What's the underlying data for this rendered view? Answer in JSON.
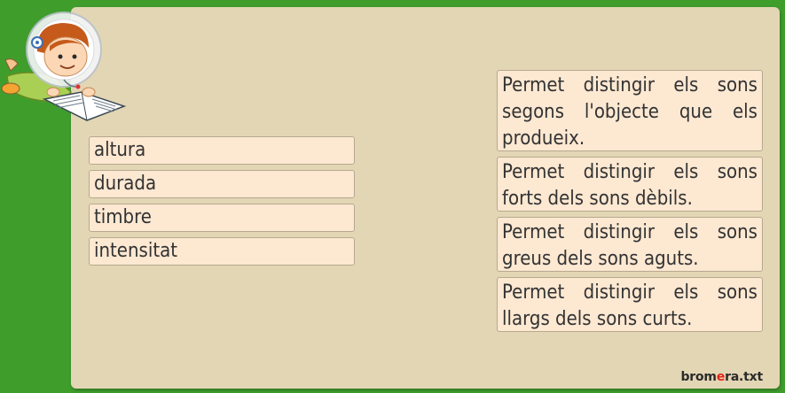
{
  "terms": [
    {
      "label": "altura"
    },
    {
      "label": "durada"
    },
    {
      "label": "timbre"
    },
    {
      "label": "intensitat"
    }
  ],
  "definitions": [
    {
      "text": "Permet distingir els sons segons l'objecte que els produeix."
    },
    {
      "text": "Permet distingir els sons forts dels sons dèbils."
    },
    {
      "text": "Permet distingir els sons greus dels sons aguts."
    },
    {
      "text": "Permet distingir els sons llargs dels sons curts."
    }
  ],
  "brand": {
    "prefix": "brom",
    "accent": "e",
    "suffix": "ra.txt",
    "accent_color": "#e2231a"
  },
  "colors": {
    "background": "#3f9d2c",
    "panel": "#e3d6b4",
    "card": "#fde8d2"
  },
  "mascot": {
    "icon": "astronaut-reading-icon"
  }
}
